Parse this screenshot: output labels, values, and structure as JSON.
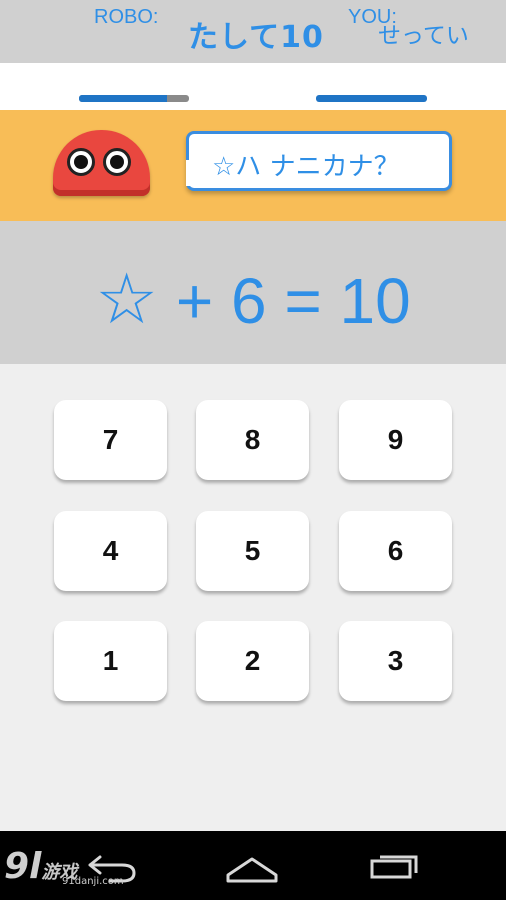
{
  "header": {
    "title": "たして10",
    "settings_label": "せってい"
  },
  "scores": {
    "robo_label": "ROBO:",
    "you_label": "YOU:",
    "robo_progress": 0.8,
    "you_progress": 1.0
  },
  "robot": {
    "speech": "☆ハ ナニカナ？"
  },
  "equation": {
    "unknown_symbol": "☆",
    "operator": "+",
    "addend": "6",
    "equals": "=",
    "total": "10"
  },
  "keypad": {
    "keys": [
      {
        "label": "7"
      },
      {
        "label": "8"
      },
      {
        "label": "9"
      },
      {
        "label": "4"
      },
      {
        "label": "5"
      },
      {
        "label": "6"
      },
      {
        "label": "1"
      },
      {
        "label": "2"
      },
      {
        "label": "3"
      }
    ]
  },
  "navbar": {
    "icons": [
      "back-icon",
      "home-icon",
      "recents-icon"
    ]
  },
  "watermark": {
    "brand_number": "9l",
    "brand_text": "游戏",
    "url": "91danji.com"
  },
  "colors": {
    "accent": "#2f8fe6",
    "robot_band": "#f8bd57",
    "robot_body": "#e9473f",
    "panel_gray": "#d0d0d0",
    "background": "#efefef"
  }
}
